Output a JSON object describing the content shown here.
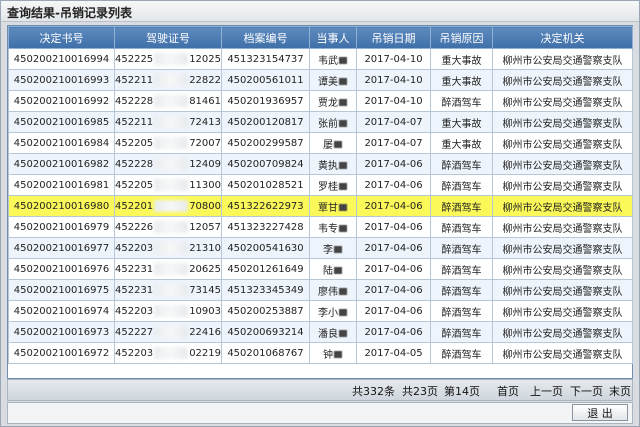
{
  "window": {
    "title": "查询结果-吊销记录列表"
  },
  "table": {
    "headers": [
      "决定书号",
      "驾驶证号",
      "档案编号",
      "当事人",
      "吊销日期",
      "吊销原因",
      "决定机关"
    ],
    "rows": [
      {
        "decision_no": "450200210016994",
        "license_prefix": "452225",
        "license_suffix": "1202515",
        "file_no": "451323154737",
        "party": "韦武",
        "date": "2017-04-10",
        "reason": "重大事故",
        "authority": "柳州市公安局交通警察支队"
      },
      {
        "decision_no": "450200210016993",
        "license_prefix": "452211",
        "license_suffix": "2282229",
        "file_no": "450200561011",
        "party": "谭美",
        "date": "2017-04-10",
        "reason": "重大事故",
        "authority": "柳州市公安局交通警察支队"
      },
      {
        "decision_no": "450200210016992",
        "license_prefix": "452228",
        "license_suffix": "8146116",
        "file_no": "450201936957",
        "party": "贾龙",
        "date": "2017-04-10",
        "reason": "醉酒驾车",
        "authority": "柳州市公安局交通警察支队"
      },
      {
        "decision_no": "450200210016985",
        "license_prefix": "452211",
        "license_suffix": "7241312",
        "file_no": "450200120817",
        "party": "张前",
        "date": "2017-04-07",
        "reason": "重大事故",
        "authority": "柳州市公安局交通警察支队"
      },
      {
        "decision_no": "450200210016984",
        "license_prefix": "452205",
        "license_suffix": "7200730",
        "file_no": "450200299587",
        "party": "屡",
        "date": "2017-04-07",
        "reason": "重大事故",
        "authority": "柳州市公安局交通警察支队"
      },
      {
        "decision_no": "450200210016982",
        "license_prefix": "452228",
        "license_suffix": "1240919",
        "file_no": "450200709824",
        "party": "黄执",
        "date": "2017-04-06",
        "reason": "醉酒驾车",
        "authority": "柳州市公安局交通警察支队"
      },
      {
        "decision_no": "450200210016981",
        "license_prefix": "452205",
        "license_suffix": "1130036",
        "file_no": "450201028521",
        "party": "罗桂",
        "date": "2017-04-06",
        "reason": "醉酒驾车",
        "authority": "柳州市公安局交通警察支队"
      },
      {
        "decision_no": "450200210016980",
        "license_prefix": "452201",
        "license_suffix": "7080012",
        "file_no": "451322622973",
        "party": "覃甘",
        "date": "2017-04-06",
        "reason": "醉酒驾车",
        "authority": "柳州市公安局交通警察支队"
      },
      {
        "decision_no": "450200210016979",
        "license_prefix": "452226",
        "license_suffix": "1205719",
        "file_no": "451323227428",
        "party": "韦专",
        "date": "2017-04-06",
        "reason": "醉酒驾车",
        "authority": "柳州市公安局交通警察支队"
      },
      {
        "decision_no": "450200210016977",
        "license_prefix": "452203",
        "license_suffix": "2131016",
        "file_no": "450200541630",
        "party": "李",
        "date": "2017-04-06",
        "reason": "醉酒驾车",
        "authority": "柳州市公安局交通警察支队"
      },
      {
        "decision_no": "450200210016976",
        "license_prefix": "452231",
        "license_suffix": "2062593",
        "file_no": "450201261649",
        "party": "陆",
        "date": "2017-04-06",
        "reason": "醉酒驾车",
        "authority": "柳州市公安局交通警察支队"
      },
      {
        "decision_no": "450200210016975",
        "license_prefix": "452231",
        "license_suffix": "7314515",
        "file_no": "451323345349",
        "party": "廖伟",
        "date": "2017-04-06",
        "reason": "醉酒驾车",
        "authority": "柳州市公安局交通警察支队"
      },
      {
        "decision_no": "450200210016974",
        "license_prefix": "452203",
        "license_suffix": "1090315",
        "file_no": "450200253887",
        "party": "李小",
        "date": "2017-04-06",
        "reason": "醉酒驾车",
        "authority": "柳州市公安局交通警察支队"
      },
      {
        "decision_no": "450200210016973",
        "license_prefix": "452227",
        "license_suffix": "2241617",
        "file_no": "450200693214",
        "party": "潘良",
        "date": "2017-04-06",
        "reason": "醉酒驾车",
        "authority": "柳州市公安局交通警察支队"
      },
      {
        "decision_no": "450200210016972",
        "license_prefix": "452203",
        "license_suffix": "0221934",
        "file_no": "450201068767",
        "party": "钟",
        "date": "2017-04-05",
        "reason": "醉酒驾车",
        "authority": "柳州市公安局交通警察支队"
      }
    ],
    "highlight_row": 7,
    "colors": {
      "header": "#4a7ab3",
      "highlight": "#fbf95a"
    }
  },
  "pager": {
    "total_records": "共332条",
    "total_pages": "共23页",
    "current_page": "第14页",
    "first": "首页",
    "prev": "上一页",
    "next": "下一页",
    "last": "末页"
  },
  "footer": {
    "exit_label": "退 出"
  }
}
